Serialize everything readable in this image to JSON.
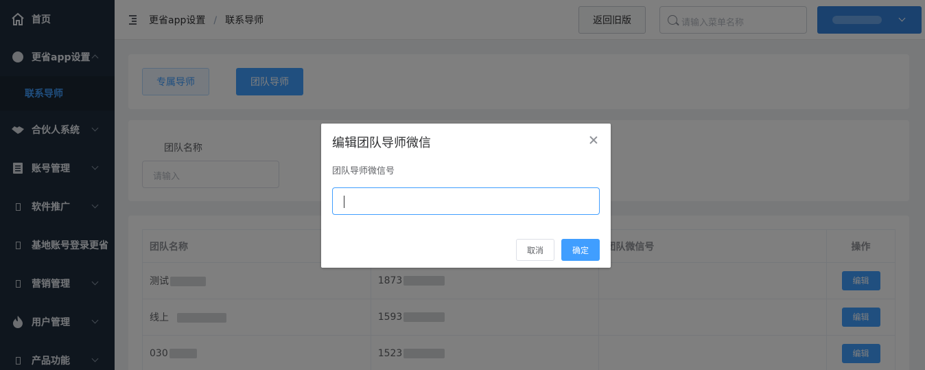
{
  "sidebar": {
    "items": [
      {
        "label": "首页",
        "icon": "home-icon"
      },
      {
        "label": "更省app设置",
        "icon": "circle-icon"
      },
      {
        "label": "合伙人系统",
        "icon": "handshake-icon"
      },
      {
        "label": "账号管理",
        "icon": "document-icon"
      },
      {
        "label": "软件推广",
        "icon": "square-icon"
      },
      {
        "label": "基地账号登录更省",
        "icon": "square-icon"
      },
      {
        "label": "营销管理",
        "icon": "square-icon"
      },
      {
        "label": "用户管理",
        "icon": "fire-icon"
      },
      {
        "label": "产品功能",
        "icon": "square-icon"
      }
    ],
    "active_sub": "联系导师"
  },
  "header": {
    "breadcrumb": [
      "更省app设置",
      "联系导师"
    ],
    "breadcrumb_sep": "/",
    "old_version_label": "返回旧版",
    "search_placeholder": "请输入菜单名称"
  },
  "tabs": {
    "exclusive": "专属导师",
    "team": "团队导师"
  },
  "filter": {
    "label": "团队名称",
    "placeholder": "请输入"
  },
  "table": {
    "headers": [
      "团队名称",
      "",
      "团队微信号",
      "操作"
    ],
    "rows": [
      {
        "name": "测试",
        "phone": "1873",
        "wechat": "",
        "action": "编辑"
      },
      {
        "name": "线上",
        "phone": "1593",
        "wechat": "",
        "action": "编辑"
      },
      {
        "name": "030",
        "phone": "1523",
        "wechat": "",
        "action": "编辑"
      }
    ]
  },
  "dialog": {
    "title": "编辑团队导师微信",
    "field_label": "团队导师微信号",
    "field_value": "",
    "cancel_label": "取消",
    "confirm_label": "确定"
  }
}
